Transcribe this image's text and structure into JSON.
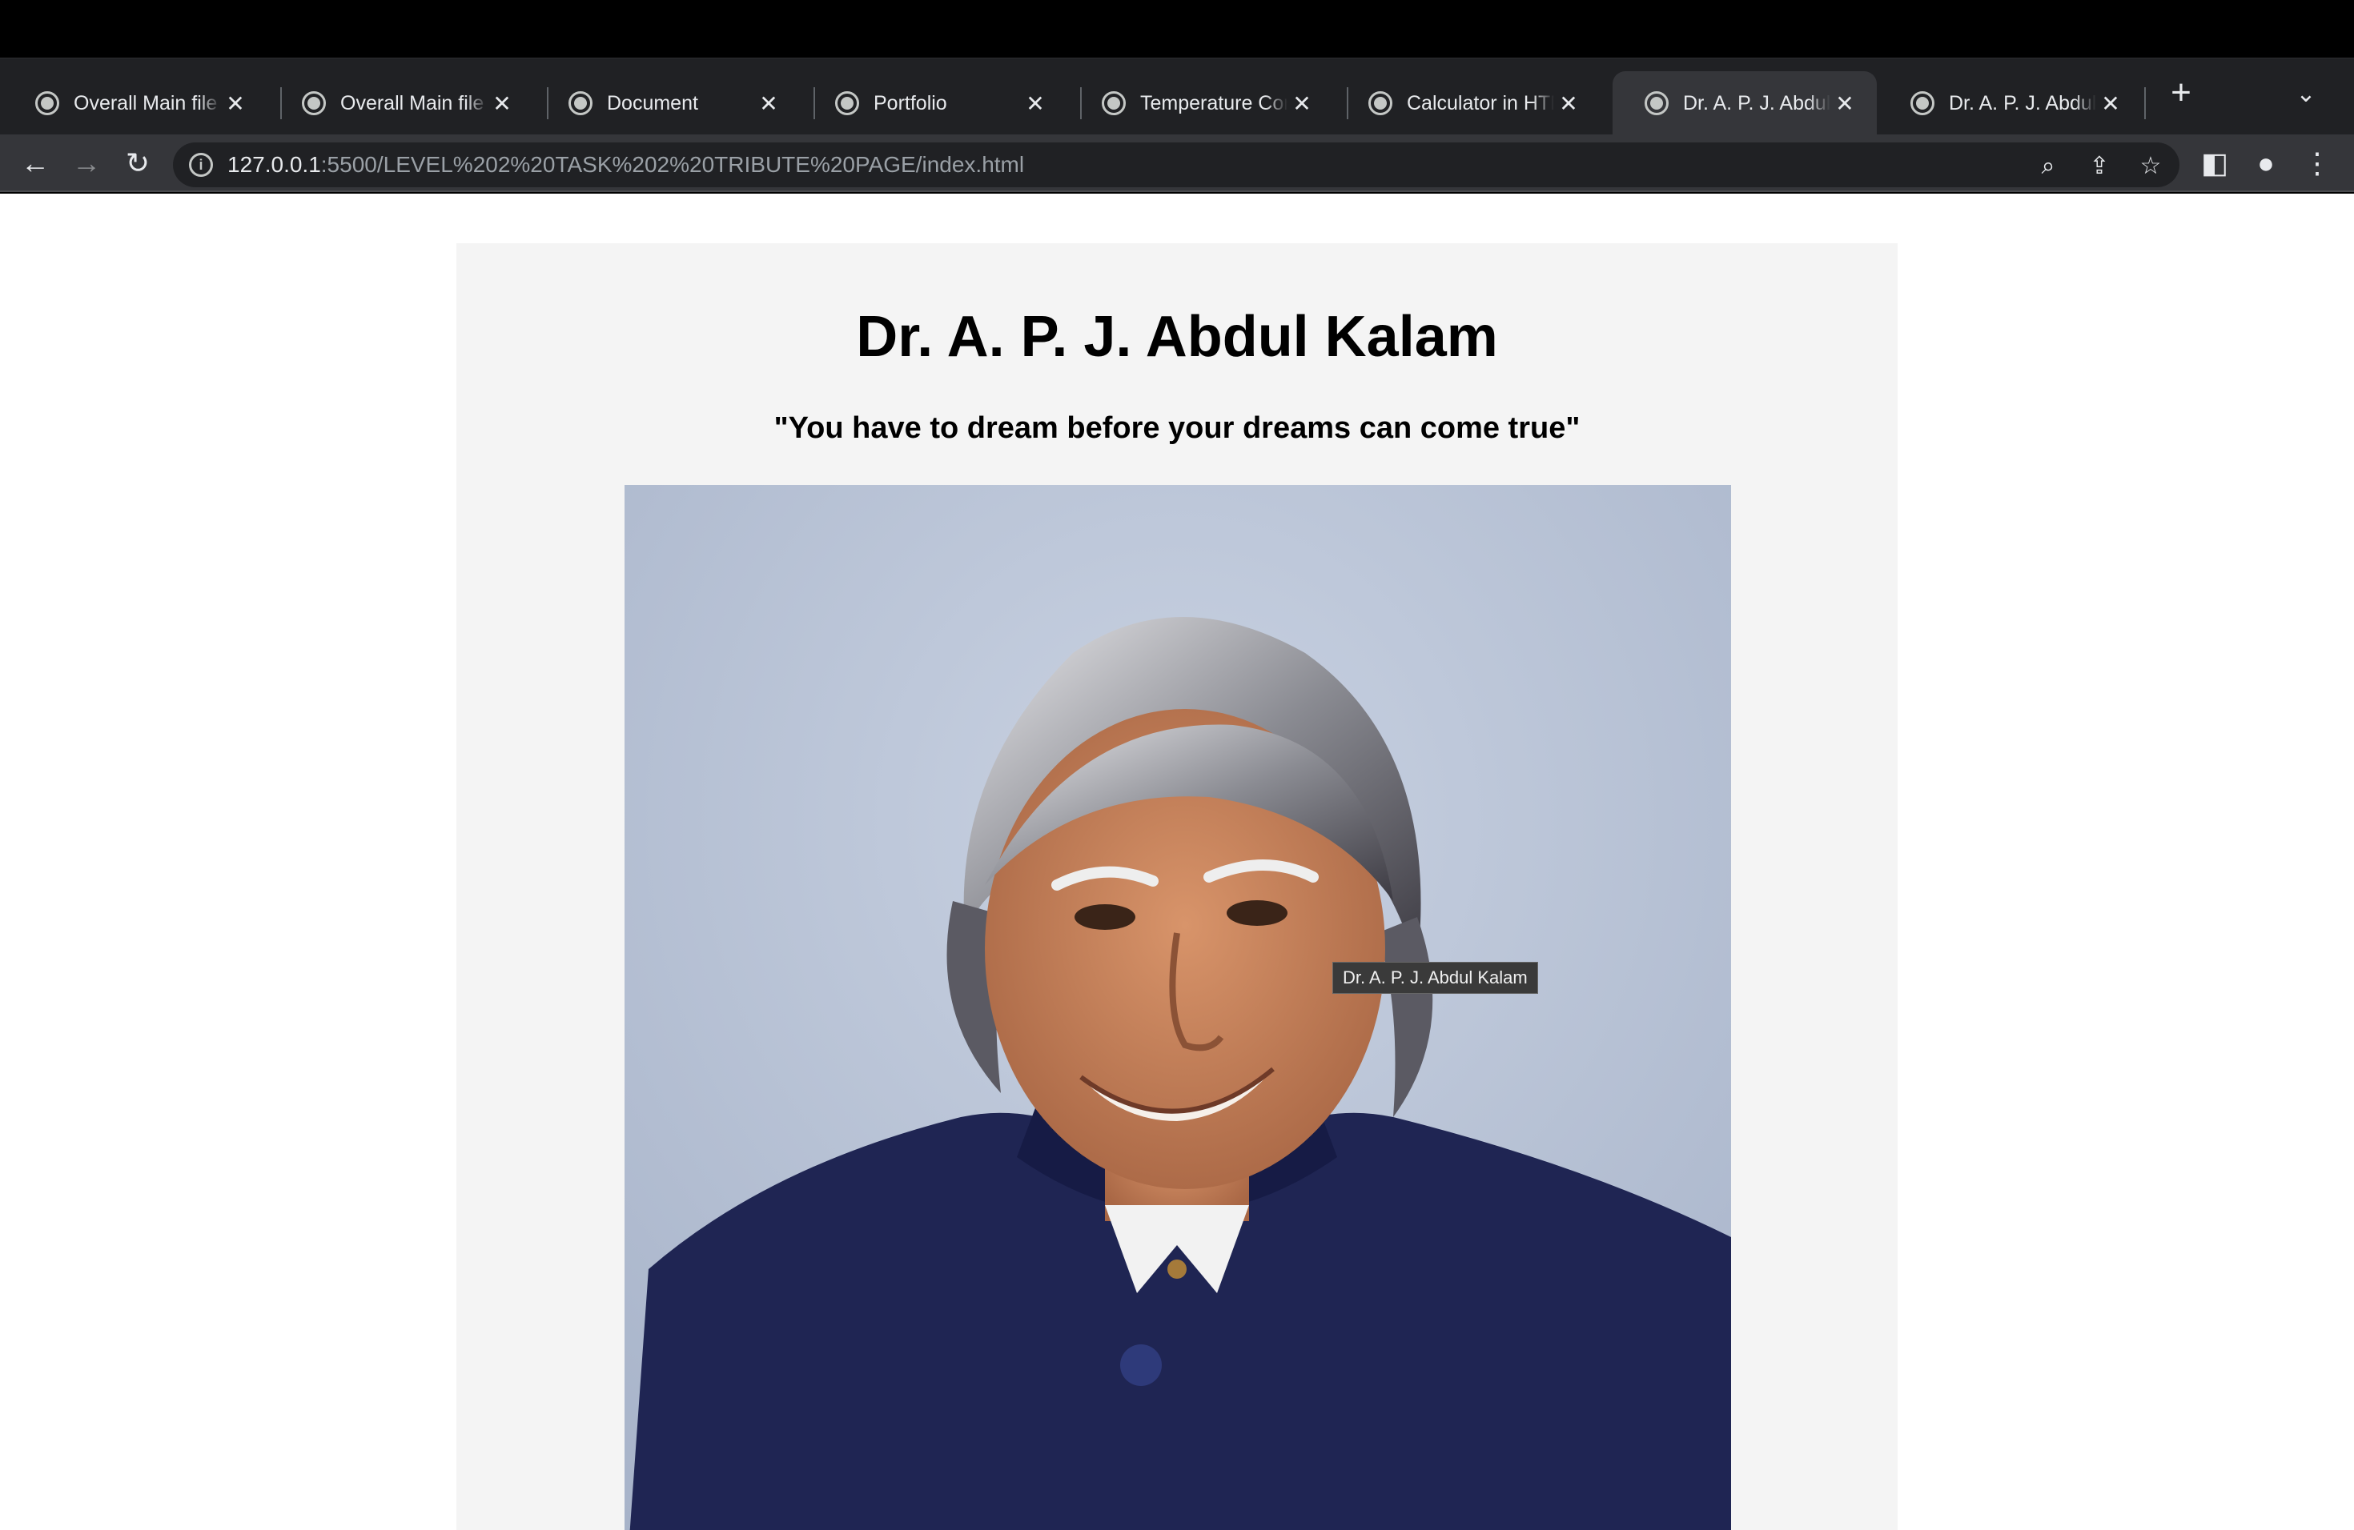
{
  "browser": {
    "tabs": [
      {
        "title": "Overall Main file",
        "active": false
      },
      {
        "title": "Overall Main file",
        "active": false
      },
      {
        "title": "Document",
        "active": false
      },
      {
        "title": "Portfolio",
        "active": false
      },
      {
        "title": "Temperature Con",
        "active": false
      },
      {
        "title": "Calculator in HTM",
        "active": false
      },
      {
        "title": "Dr. A. P. J. Abdul",
        "active": true
      },
      {
        "title": "Dr. A. P. J. Abdul",
        "active": false
      }
    ],
    "address": {
      "host": "127.0.0.1",
      "rest": ":5500/LEVEL%202%20TASK%202%20TRIBUTE%20PAGE/index.html"
    }
  },
  "page": {
    "title": "Dr. A. P. J. Abdul Kalam",
    "quote": "\"You have to dream before your dreams can come true\"",
    "image_tooltip": "Dr. A. P. J. Abdul Kalam"
  },
  "colors": {
    "tabstrip": "#202124",
    "toolbar": "#35363a",
    "card": "#f4f4f4",
    "suit": "#1f2553",
    "photo_bg": "#b7c2d6"
  }
}
